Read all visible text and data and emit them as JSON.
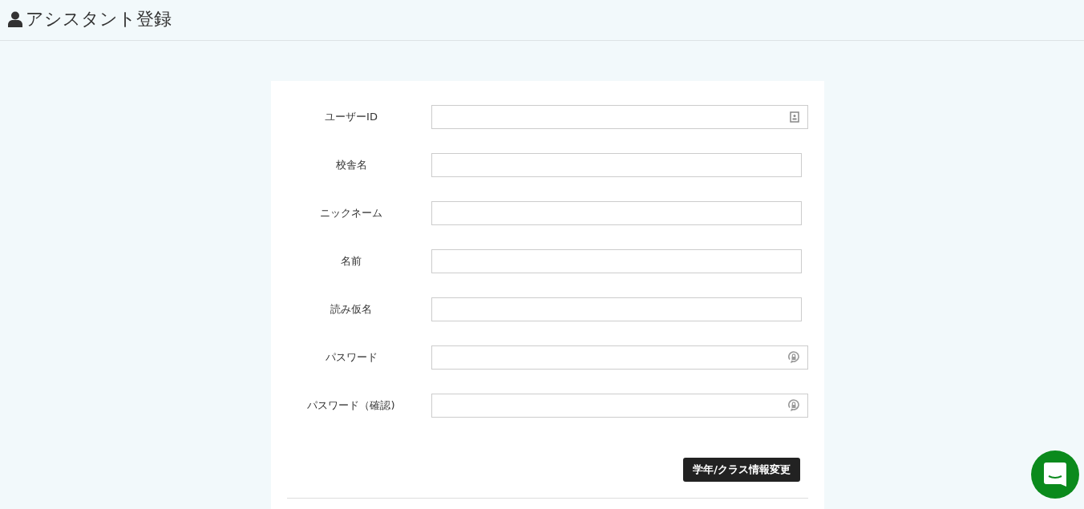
{
  "header": {
    "title": "アシスタント登録"
  },
  "fields": [
    {
      "label": "ユーザーID",
      "kind": "id"
    },
    {
      "label": "校舎名",
      "kind": "text"
    },
    {
      "label": "ニックネーム",
      "kind": "text"
    },
    {
      "label": "名前",
      "kind": "text"
    },
    {
      "label": "読み仮名",
      "kind": "text"
    },
    {
      "label": "パスワード",
      "kind": "password"
    },
    {
      "label": "パスワード（確認)",
      "kind": "password"
    }
  ],
  "button": {
    "label": "学年/クラス情報変更"
  }
}
